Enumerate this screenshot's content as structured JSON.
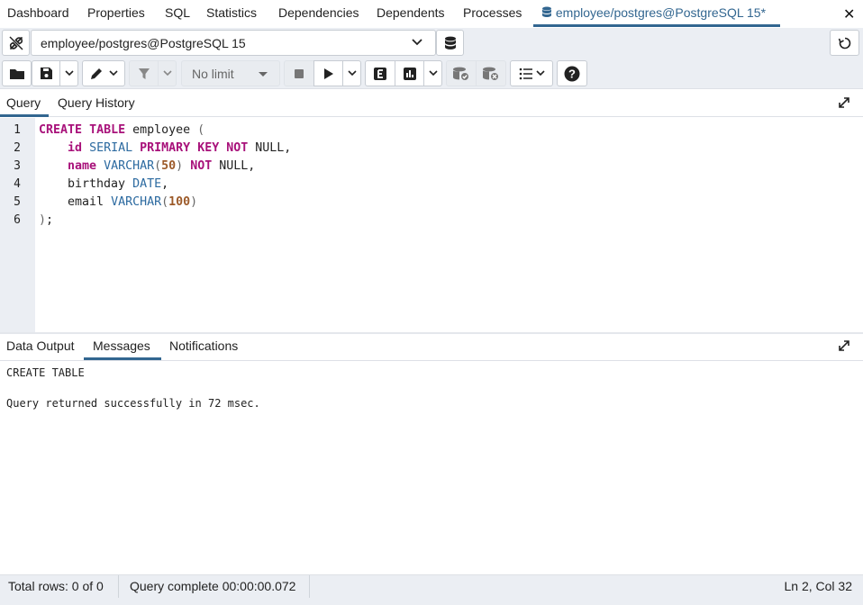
{
  "top_tabs": {
    "items": [
      "Dashboard",
      "Properties",
      "SQL",
      "Statistics",
      "Dependencies",
      "Dependents",
      "Processes"
    ],
    "active": "employee/postgres@PostgreSQL 15*"
  },
  "connection": {
    "value": "employee/postgres@PostgreSQL 15"
  },
  "toolbar": {
    "limit_value": "No limit"
  },
  "query_tabs": {
    "query": "Query",
    "history": "Query History"
  },
  "editor": {
    "line_numbers": [
      "1",
      "2",
      "3",
      "4",
      "5",
      "6"
    ],
    "lines": [
      [
        {
          "t": "CREATE",
          "c": "kw"
        },
        {
          "t": " "
        },
        {
          "t": "TABLE",
          "c": "kw"
        },
        {
          "t": " employee "
        },
        {
          "t": "(",
          "c": "br"
        }
      ],
      [
        {
          "t": "    "
        },
        {
          "t": "id",
          "c": "kw"
        },
        {
          "t": " "
        },
        {
          "t": "SERIAL",
          "c": "ty"
        },
        {
          "t": " "
        },
        {
          "t": "PRIMARY",
          "c": "kw"
        },
        {
          "t": " "
        },
        {
          "t": "KEY",
          "c": "kw"
        },
        {
          "t": " "
        },
        {
          "t": "NOT",
          "c": "kw"
        },
        {
          "t": " NULL,"
        }
      ],
      [
        {
          "t": "    "
        },
        {
          "t": "name",
          "c": "kw"
        },
        {
          "t": " "
        },
        {
          "t": "VARCHAR",
          "c": "ty"
        },
        {
          "t": "(",
          "c": "br"
        },
        {
          "t": "50",
          "c": "num"
        },
        {
          "t": ")",
          "c": "br"
        },
        {
          "t": " "
        },
        {
          "t": "NOT",
          "c": "kw"
        },
        {
          "t": " NULL,"
        }
      ],
      [
        {
          "t": "    birthday "
        },
        {
          "t": "DATE",
          "c": "ty"
        },
        {
          "t": ","
        }
      ],
      [
        {
          "t": "    email "
        },
        {
          "t": "VARCHAR",
          "c": "ty"
        },
        {
          "t": "(",
          "c": "br"
        },
        {
          "t": "100",
          "c": "num"
        },
        {
          "t": ")",
          "c": "br"
        }
      ],
      [
        {
          "t": ")",
          "c": "br"
        },
        {
          "t": ";"
        }
      ]
    ]
  },
  "output_tabs": {
    "data_output": "Data Output",
    "messages": "Messages",
    "notifications": "Notifications"
  },
  "messages": {
    "line1": "CREATE TABLE",
    "line2": "Query returned successfully in 72 msec."
  },
  "status": {
    "total_rows": "Total rows: 0 of 0",
    "query_complete": "Query complete 00:00:00.072",
    "position": "Ln 2, Col 32"
  },
  "colors": {
    "accent": "#326690",
    "keyword": "#a8117a",
    "type": "#2c6aa0",
    "number": "#9c5a29",
    "panel_bg": "#ebeef3"
  }
}
